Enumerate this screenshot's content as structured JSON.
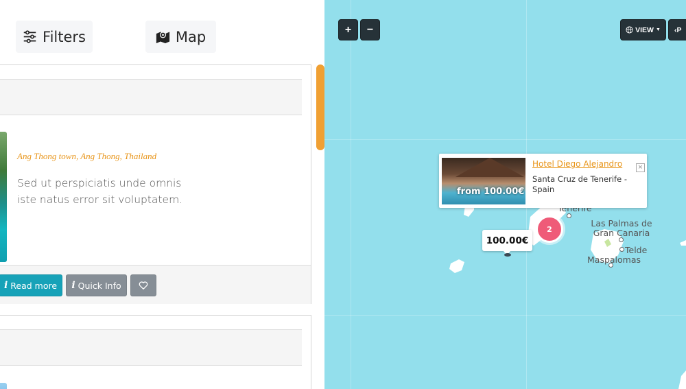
{
  "toolbar": {
    "filters_label": "Filters",
    "map_label": "Map"
  },
  "listing": {
    "location_parts": [
      "Ang Thong town",
      "Ang Thong",
      "Thailand"
    ],
    "location_separator": ", ",
    "description": "Sed ut perspiciatis unde omnis iste natus error sit voluptatem.",
    "read_more_label": "Read more",
    "quick_info_label": "Quick Info",
    "info_glyph": "i"
  },
  "map": {
    "zoom_in": "+",
    "zoom_out": "−",
    "view_label": "VIEW",
    "prev_label": "P",
    "popup": {
      "title": "Hotel Diego Alejandro",
      "address": "Santa Cruz de Tenerife - Spain",
      "image_price": "from 100.00€",
      "close": "×"
    },
    "price_marker": "100.00€",
    "cluster_count": "2",
    "places": {
      "tenerife": "Tenerife",
      "las_palmas": "Las Palmas de Gran Canaria",
      "telde": "Telde",
      "maspalomas": "Maspalomas"
    }
  },
  "colors": {
    "accent": "#e8951a",
    "map_water": "#93dfec",
    "read_more": "#17a2b8",
    "secondary": "#868e96",
    "cluster": "#ef5b78",
    "map_controls": "#263238"
  }
}
